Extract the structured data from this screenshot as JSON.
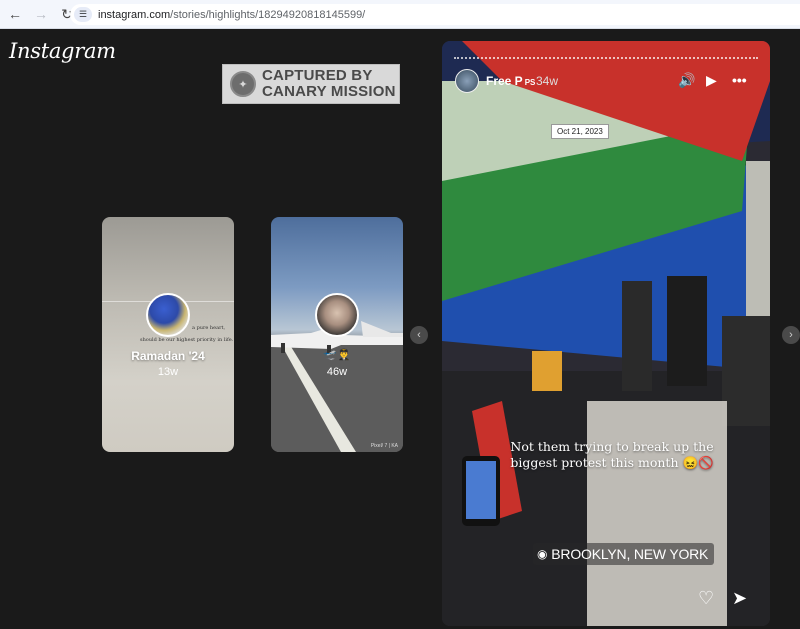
{
  "browser": {
    "back_icon": "arrow-left-icon",
    "forward_icon": "arrow-right-icon",
    "reload_icon": "reload-icon",
    "url_host": "instagram.com",
    "url_path": "/stories/highlights/18294920818145599/"
  },
  "logo": "Instagram",
  "stamp": {
    "line1": "CAPTURED BY",
    "line2": "CANARY MISSION"
  },
  "highlights": [
    {
      "title": "Ramadan '24",
      "age": "13w",
      "tiny_text_1": "a pure heart,",
      "tiny_text_2": "should be our highest priority in life."
    },
    {
      "title": "",
      "emoji": "🛫👨‍✈️",
      "age": "46w",
      "watermark": "Pixel/ 7 | KA"
    }
  ],
  "story": {
    "username": "Free P",
    "badge": "PS",
    "time": "34w",
    "tooltip": "Oct 21, 2023",
    "caption": "Not them trying to break up the biggest protest this month 😖🚫",
    "location": "BROOKLYN, NEW YORK"
  },
  "colors": {
    "background": "#1a1a1a",
    "flag_red": "#c8312b",
    "flag_green": "#2f8a3e",
    "sky_blue": "#1f4fae"
  }
}
